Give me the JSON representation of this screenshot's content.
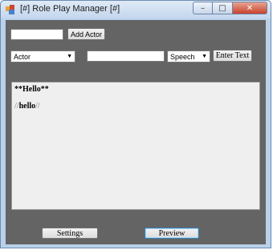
{
  "window": {
    "title": "[#] Role Play Manager [#]",
    "minimize_glyph": "–",
    "maximize_glyph": "□",
    "close_glyph": "✕"
  },
  "actor_input": {
    "value": ""
  },
  "add_actor_button": {
    "label": "Add Actor"
  },
  "actor_select": {
    "selected": "Actor"
  },
  "speech_input": {
    "value": ""
  },
  "speech_type_select": {
    "selected": "Speech"
  },
  "enter_text_button": {
    "label": "Enter Text"
  },
  "output": {
    "line1": "**Hello**",
    "line2_prefix": "//",
    "line2_word": "hello",
    "line2_suffix": "//"
  },
  "settings_button": {
    "label": "Settings"
  },
  "preview_button": {
    "label": "Preview"
  },
  "colors": {
    "client_bg": "#646464",
    "textarea_bg": "#efefef"
  }
}
